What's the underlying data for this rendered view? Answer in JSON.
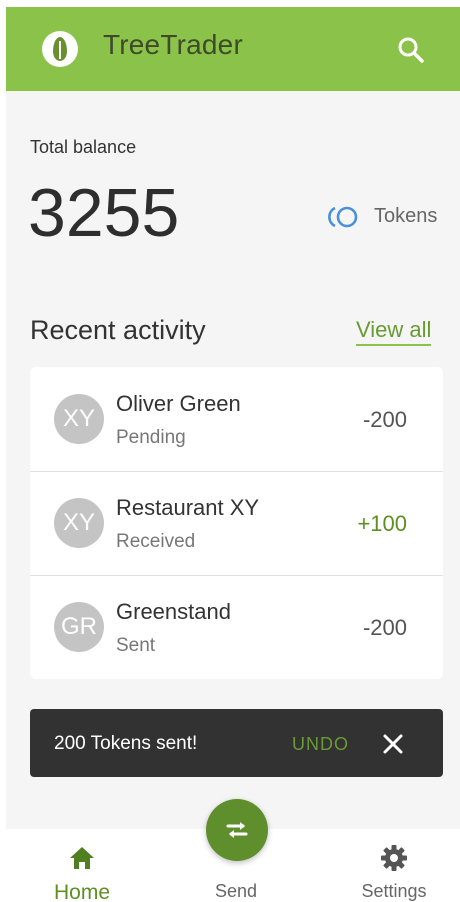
{
  "app": {
    "title": "TreeTrader"
  },
  "balance": {
    "label": "Total balance",
    "value": "3255",
    "unit": "Tokens"
  },
  "activity": {
    "title": "Recent activity",
    "view_all": "View all",
    "items": [
      {
        "initials": "XY",
        "name": "Oliver Green",
        "status": "Pending",
        "amount": "-200"
      },
      {
        "initials": "XY",
        "name": "Restaurant XY",
        "status": "Received",
        "amount": "+100"
      },
      {
        "initials": "GR",
        "name": "Greenstand",
        "status": "Sent",
        "amount": "-200"
      }
    ]
  },
  "snackbar": {
    "message": "200 Tokens sent!",
    "action": "UNDO"
  },
  "nav": {
    "home": "Home",
    "send": "Send",
    "settings": "Settings"
  },
  "icons": {
    "logo": "tree-leaf-icon",
    "search": "search-icon",
    "token": "token-icon",
    "close": "close-icon",
    "home": "home-icon",
    "send": "swap-arrows-icon",
    "settings": "gear-icon"
  },
  "colors": {
    "primary": "#8bc34a",
    "accent": "#5e8f2c",
    "snackbar": "#323232"
  }
}
